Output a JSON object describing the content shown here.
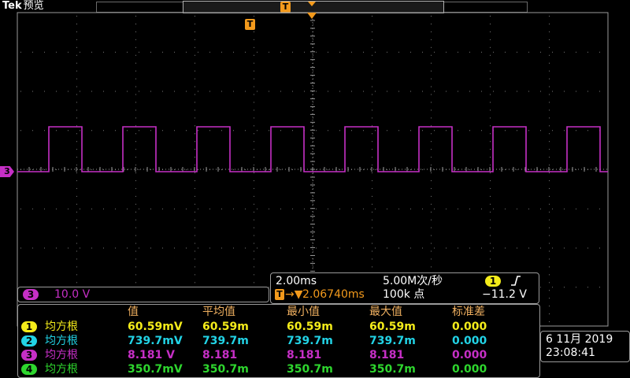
{
  "header": {
    "brand": "Tek",
    "mode": "预览"
  },
  "trigger_marker": "T",
  "channel_marker": "3",
  "channel_scale": {
    "channel": "3",
    "value": "10.0 V"
  },
  "horizontal": {
    "time_div": "2.00ms",
    "sample_rate": "5.00M次/秒",
    "trigger_pos": "2.06740ms",
    "record_len": "100k 点",
    "trig_channel": "1",
    "trig_level": "−11.2 V"
  },
  "measurements": {
    "headers": [
      "值",
      "平均值",
      "最小值",
      "最大值",
      "标准差"
    ],
    "rows": [
      {
        "channel": "1",
        "name": "均方根",
        "color": "#f4ec1a",
        "value": "60.59mV",
        "mean": "60.59m",
        "min": "60.59m",
        "max": "60.59m",
        "std": "0.000"
      },
      {
        "channel": "2",
        "name": "均方根",
        "color": "#22d3e6",
        "value": "739.7mV",
        "mean": "739.7m",
        "min": "739.7m",
        "max": "739.7m",
        "std": "0.000"
      },
      {
        "channel": "3",
        "name": "均方根",
        "color": "#c62fc6",
        "value": "8.181 V",
        "mean": "8.181",
        "min": "8.181",
        "max": "8.181",
        "std": "0.000"
      },
      {
        "channel": "4",
        "name": "均方根",
        "color": "#2ed62e",
        "value": "350.7mV",
        "mean": "350.7m",
        "min": "350.7m",
        "max": "350.7m",
        "std": "0.000"
      }
    ]
  },
  "clock": {
    "date": "6 11月 2019",
    "time": "23:08:41"
  },
  "colors": {
    "ch3": "#c62fc6",
    "trigger": "#f39a1c",
    "grid": "#9a9a9a"
  },
  "icons": {
    "trigger_slope": "rising-edge-icon"
  }
}
